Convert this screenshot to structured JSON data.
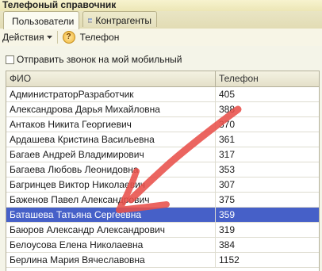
{
  "window": {
    "title": "Телефоный справочник"
  },
  "tabs": [
    {
      "label": "Пользователи",
      "icon": "user-icon",
      "active": true
    },
    {
      "label": "Контрагенты",
      "icon": "grid-icon",
      "active": false
    }
  ],
  "toolbar": {
    "actions_label": "Действия",
    "actions_icon": "dropdown-arrow-icon",
    "help_icon": "help-icon",
    "help_symbol": "?",
    "phone_label": "Телефон"
  },
  "option": {
    "label": "Отправить звонок на мой мобильный",
    "checked": false
  },
  "table": {
    "columns": [
      "ФИО",
      "Телефон"
    ],
    "rows": [
      {
        "name": "АдминистраторРазработчик",
        "phone": "405"
      },
      {
        "name": "Александрова Дарья Михайловна",
        "phone": "388"
      },
      {
        "name": "Антаков Никита Георгиевич",
        "phone": "370"
      },
      {
        "name": "Ардашева Кристина Васильевна",
        "phone": "361"
      },
      {
        "name": "Багаев Андрей Владимирович",
        "phone": "317"
      },
      {
        "name": "Багаева Любовь Леонидовна",
        "phone": "353"
      },
      {
        "name": "Багринцев Виктор Николаевич",
        "phone": "307"
      },
      {
        "name": "Баженов Павел Александрович",
        "phone": "375"
      },
      {
        "name": "Баташева Татьяна Сергеевна",
        "phone": "359",
        "selected": true
      },
      {
        "name": "Баюров Александр Александрович",
        "phone": "319"
      },
      {
        "name": "Белоусова Елена Николаевна",
        "phone": "384"
      },
      {
        "name": "Берлина Мария Вячеславовна",
        "phone": "1152"
      }
    ]
  },
  "colors": {
    "selection": "#4660c8",
    "annotation_arrow": "#e8504a"
  }
}
